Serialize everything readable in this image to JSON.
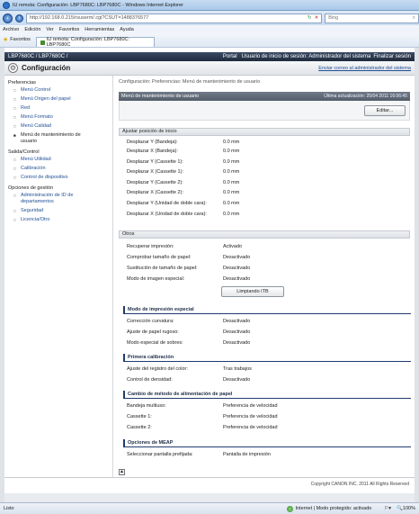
{
  "browser": {
    "window_title": "IU remota: Configuración: LBP7680C: LBP7680C - Windows Internet Explorer",
    "url": "http://192.168.0.215/rsuserm/.cgi?CSUT=1488376577",
    "url_host": "192.168.0.215",
    "search_placeholder": "Bing",
    "menu": [
      "Archivo",
      "Edición",
      "Ver",
      "Favoritos",
      "Herramientas",
      "Ayuda"
    ],
    "favorites_label": "Favoritos",
    "tab_title": "IU remota: Configuración: LBP7680C: LBP7680C",
    "status_left": "Listo",
    "status_zone": "Internet | Modo protegido: activado",
    "status_zoom": "100%"
  },
  "app": {
    "device_name": "LBP7680C / LBP7680C /",
    "portal_link": "Portal",
    "login_text": "Usuario de inicio de sesión: Administrador del sistema",
    "logout_link": "Finalizar sesión",
    "page_title": "Configuración",
    "mail_admin_link": "Enviar correo al administrador del sistema",
    "copyright": "Copyright CANON INC. 2011 All Rights Reserved"
  },
  "sidebar": {
    "sections": [
      {
        "title": "Preferencias",
        "items": [
          {
            "label": "Menú Control",
            "selected": false
          },
          {
            "label": "Menú Origen del papel",
            "selected": false
          },
          {
            "label": "Red",
            "selected": false
          },
          {
            "label": "Menú Formato",
            "selected": false
          },
          {
            "label": "Menú Calidad",
            "selected": false
          },
          {
            "label": "Menú de mantenimiento de usuario",
            "selected": true
          }
        ]
      },
      {
        "title": "Salida/Control",
        "items": [
          {
            "label": "Menú Utilidad",
            "selected": false
          },
          {
            "label": "Calibración",
            "selected": false
          },
          {
            "label": "Control de dispositivo",
            "selected": false
          }
        ]
      },
      {
        "title": "Opciones de gestión",
        "items": [
          {
            "label": "Administración de ID de departamentos",
            "selected": false
          },
          {
            "label": "Seguridad",
            "selected": false
          },
          {
            "label": "Licencia/Otro",
            "selected": false
          }
        ]
      }
    ]
  },
  "main": {
    "breadcrumb": "Configuración: Preferencias: Menú de mantenimiento de usuario",
    "panel_title": "Menú de mantenimiento de usuario",
    "last_update": "Última actualización: 25/04 2011 16:06:45",
    "edit_button": "Editar...",
    "section_position": {
      "title": "Ajustar posición de inicio",
      "rows": [
        {
          "k": "Desplazar Y (Bandeja):",
          "v": "0.0 mm"
        },
        {
          "k": "Desplazar X (Bandeja):",
          "v": "0.0 mm"
        },
        {
          "k": "Desplazar Y (Cassette 1):",
          "v": "0.0 mm"
        },
        {
          "k": "Desplazar X (Cassette 1):",
          "v": "0.0 mm"
        },
        {
          "k": "Desplazar Y (Cassette 2):",
          "v": "0.0 mm"
        },
        {
          "k": "Desplazar X (Cassette 2):",
          "v": "0.0 mm"
        },
        {
          "k": "Desplazar Y (Unidad de doble cara):",
          "v": "0.0 mm"
        },
        {
          "k": "Desplazar X (Unidad de doble cara):",
          "v": "0.0 mm"
        }
      ]
    },
    "section_other": {
      "title": "Otros",
      "rows": [
        {
          "k": "Recuperar impresión:",
          "v": "Activado"
        },
        {
          "k": "Comprobar tamaño de papel:",
          "v": "Desactivado"
        },
        {
          "k": "Sustitución de tamaño de papel:",
          "v": "Desactivado"
        },
        {
          "k": "Modo de imagen especial:",
          "v": "Desactivado"
        }
      ],
      "clean_button": "Limpiando ITB"
    },
    "sub_special": {
      "title": "Modo de impresión especial",
      "rows": [
        {
          "k": "Corrección curvatura:",
          "v": "Desactivado"
        },
        {
          "k": "Ajuste de papel rugoso:",
          "v": "Desactivado"
        },
        {
          "k": "Modo especial de sobres:",
          "v": "Desactivado"
        }
      ]
    },
    "sub_calib": {
      "title": "Primera calibración",
      "rows": [
        {
          "k": "Ajuste del registro del color:",
          "v": "Tras trabajos"
        },
        {
          "k": "Control de densidad:",
          "v": "Desactivado"
        }
      ]
    },
    "sub_feed": {
      "title": "Cambio de método de alimentación de papel",
      "rows": [
        {
          "k": "Bandeja multiuso:",
          "v": "Preferencia de velocidad"
        },
        {
          "k": "Cassette 1:",
          "v": "Preferencia de velocidad"
        },
        {
          "k": "Cassette 2:",
          "v": "Preferencia de velocidad"
        }
      ]
    },
    "sub_meap": {
      "title": "Opciones de MEAP",
      "rows": [
        {
          "k": "Seleccionar pantalla prefijada:",
          "v": "Pantalla de impresión"
        }
      ]
    }
  }
}
